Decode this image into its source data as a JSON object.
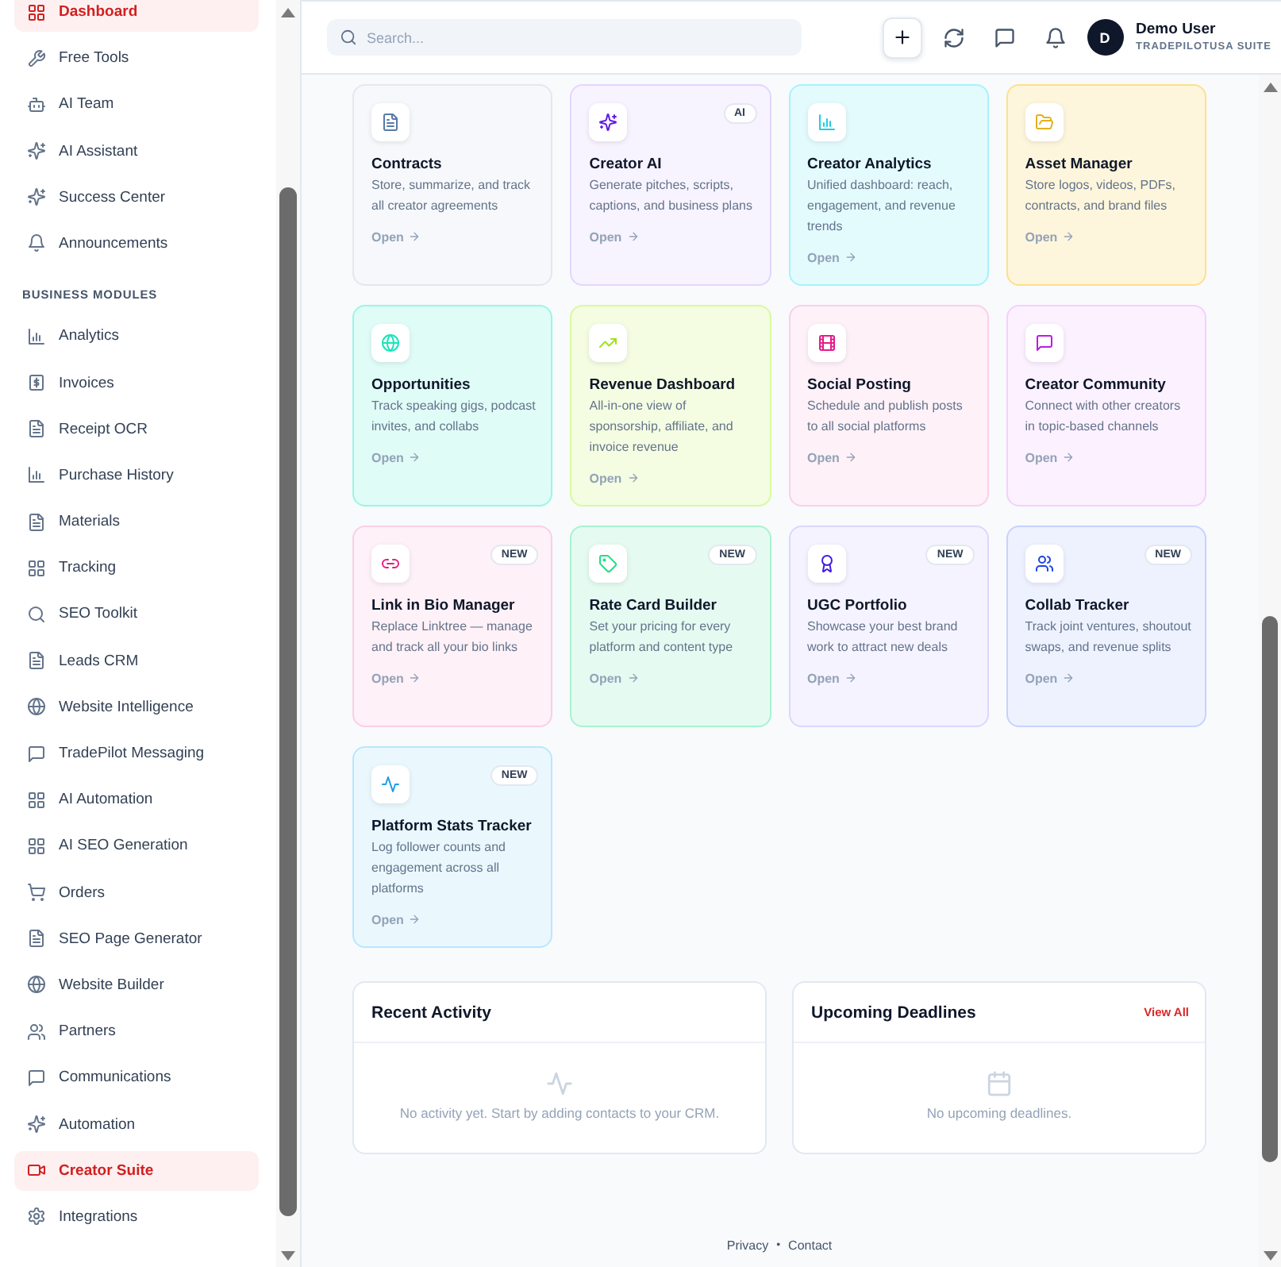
{
  "sidebar": {
    "groups": [
      {
        "items": [
          {
            "label": "Dashboard",
            "selected": true
          },
          {
            "label": "Free Tools",
            "selected": false
          },
          {
            "label": "AI Team",
            "selected": false
          },
          {
            "label": "AI Assistant",
            "selected": false
          },
          {
            "label": "Success Center",
            "selected": false
          },
          {
            "label": "Announcements",
            "selected": false
          }
        ]
      },
      {
        "title": "BUSINESS MODULES",
        "items": [
          {
            "label": "Analytics",
            "selected": false
          },
          {
            "label": "Invoices",
            "selected": false
          },
          {
            "label": "Receipt OCR",
            "selected": false
          },
          {
            "label": "Purchase History",
            "selected": false
          },
          {
            "label": "Materials",
            "selected": false
          },
          {
            "label": "Tracking",
            "selected": false
          },
          {
            "label": "SEO Toolkit",
            "selected": false
          },
          {
            "label": "Leads CRM",
            "selected": false
          },
          {
            "label": "Website Intelligence",
            "selected": false
          },
          {
            "label": "TradePilot Messaging",
            "selected": false
          },
          {
            "label": "AI Automation",
            "selected": false
          },
          {
            "label": "AI SEO Generation",
            "selected": false
          },
          {
            "label": "Orders",
            "selected": false
          },
          {
            "label": "SEO Page Generator",
            "selected": false
          },
          {
            "label": "Website Builder",
            "selected": false
          },
          {
            "label": "Partners",
            "selected": false
          },
          {
            "label": "Communications",
            "selected": false
          },
          {
            "label": "Automation",
            "selected": false
          },
          {
            "label": "Creator Suite",
            "selected": true
          },
          {
            "label": "Integrations",
            "selected": false
          }
        ]
      }
    ]
  },
  "header": {
    "search": {
      "placeholder": "Search..."
    },
    "user": {
      "initial": "D",
      "name": "Demo User",
      "subtitle": "TRADEPILOTUSA SUITE"
    }
  },
  "cards": [
    {
      "title": "Contracts",
      "description": "Store, summarize, and track all creator agreements",
      "link": "Open",
      "color": "#e2e8f0"
    },
    {
      "title": "Creator AI",
      "badge": "AI",
      "description": "Generate pitches, scripts, captions, and business plans",
      "link": "Open",
      "color": "#e4d6fe"
    },
    {
      "title": "Creator Analytics",
      "description": "Unified dashboard: reach, engagement, and revenue trends",
      "link": "Open",
      "color": "#a5f3fc"
    },
    {
      "title": "Asset Manager",
      "description": "Store logos, videos, PDFs, contracts, and brand files",
      "link": "Open",
      "color": "#fde08a"
    },
    {
      "title": "Opportunities",
      "description": "Track speaking gigs, podcast invites, and collabs",
      "link": "Open",
      "color": "#99f6e4"
    },
    {
      "title": "Revenue Dashboard",
      "description": "All-in-one view of sponsorship, affiliate, and invoice revenue",
      "link": "Open",
      "color": "#d9f99d"
    },
    {
      "title": "Social Posting",
      "description": "Schedule and publish posts to all social platforms",
      "link": "Open",
      "color": "#fbcfe8"
    },
    {
      "title": "Creator Community",
      "description": "Connect with other creators in topic-based channels",
      "link": "Open",
      "color": "#f5d0fe"
    },
    {
      "title": "Link in Bio Manager",
      "badge": "NEW",
      "description": "Replace Linktree — manage and track all your bio links",
      "link": "Open",
      "color": "#fbcfe4"
    },
    {
      "title": "Rate Card Builder",
      "badge": "NEW",
      "description": "Set your pricing for every platform and content type",
      "link": "Open",
      "color": "#a7f3d0"
    },
    {
      "title": "UGC Portfolio",
      "badge": "NEW",
      "description": "Showcase your best brand work to attract new deals",
      "link": "Open",
      "color": "#ddd6fe"
    },
    {
      "title": "Collab Tracker",
      "badge": "NEW",
      "description": "Track joint ventures, shoutout swaps, and revenue splits",
      "link": "Open",
      "color": "#c7d2fe"
    },
    {
      "title": "Platform Stats Tracker",
      "badge": "NEW",
      "description": "Log follower counts and engagement across all platforms",
      "link": "Open",
      "color": "#bae6fd"
    }
  ],
  "panels": [
    {
      "title": "Recent Activity",
      "empty_text": "No activity yet. Start by adding contacts to your CRM."
    },
    {
      "title": "Upcoming Deadlines",
      "action": "View All",
      "empty_text": "No upcoming deadlines."
    }
  ],
  "footer": {
    "links": [
      "Privacy",
      "Contact"
    ],
    "separator": "•"
  }
}
